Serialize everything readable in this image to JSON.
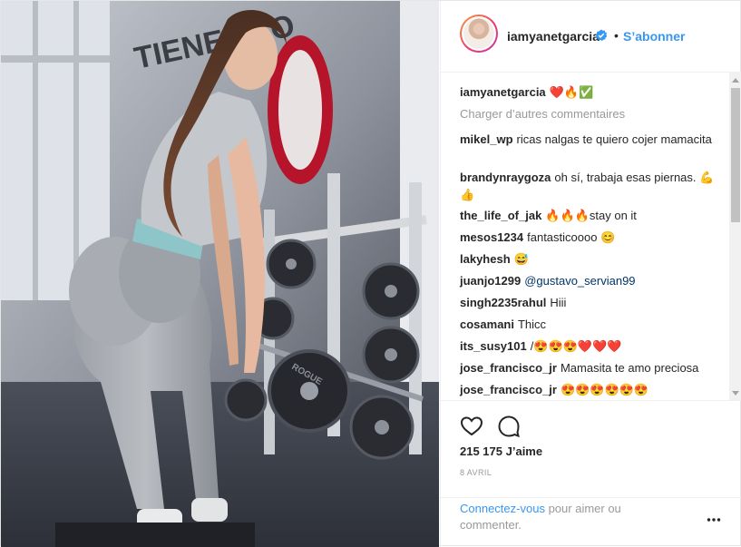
{
  "post": {
    "username": "iamyanetgarcia",
    "follow_label": "S’abonner",
    "separator": "•",
    "caption_emoji": "❤️🔥✅",
    "load_more": "Charger d’autres commentaires",
    "comments": [
      {
        "user": "mikel_wp",
        "text": "ricas nalgas te quiero cojer mamacita"
      },
      {
        "user": "brandynraygoza",
        "text": "oh sí, trabaja esas piernas. 💪👍"
      },
      {
        "user": "the_life_of_jak",
        "text": "🔥🔥🔥stay on it"
      },
      {
        "user": "mesos1234",
        "text": "fantasticoooo 😊"
      },
      {
        "user": "lakyhesh",
        "text": "😅"
      },
      {
        "user": "juanjo1299",
        "text": "@gustavo_servian99"
      },
      {
        "user": "singh2235rahul",
        "text": "Hiii"
      },
      {
        "user": "cosamani",
        "text": "Thicc"
      },
      {
        "user": "its_susy101",
        "text": "/😍😍😍❤️❤️❤️"
      },
      {
        "user": "jose_francisco_jr",
        "text": "Mamasita te amo preciosa"
      },
      {
        "user": "jose_francisco_jr",
        "text": "😍😍😍😍😍😍"
      }
    ],
    "likes_count": "215 175",
    "likes_label": "J’aime",
    "date": "8 AVRIL",
    "login_link": "Connectez-vous",
    "login_rest": "pour aimer ou commenter."
  },
  "photo": {
    "wall_text": "TIENES LO",
    "plate_brand": "ROGUE"
  },
  "icons": {
    "verified": "verified-badge-icon",
    "like": "heart-outline-icon",
    "comment": "speech-bubble-icon",
    "more": "three-dots-icon"
  },
  "colors": {
    "link_blue": "#3897f0",
    "text": "#262626",
    "muted": "#999999",
    "border": "#efefef"
  }
}
